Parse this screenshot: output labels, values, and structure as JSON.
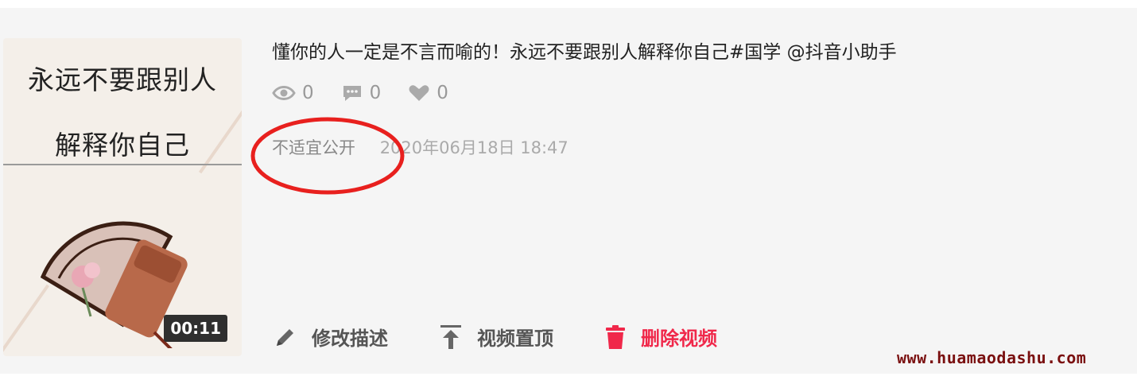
{
  "video": {
    "thumbnail_caption_line1": "永远不要跟别人",
    "thumbnail_caption_line2": "解释你自己",
    "duration": "00:11",
    "title": "懂你的人一定是不言而喻的！永远不要跟别人解释你自己#国学 @抖音小助手",
    "stats": {
      "views": "0",
      "comments": "0",
      "likes": "0"
    },
    "privacy_status": "不适宜公开",
    "timestamp": "2020年06月18日 18:47"
  },
  "actions": {
    "edit_label": "修改描述",
    "pin_label": "视频置顶",
    "delete_label": "删除视频"
  },
  "watermark": "www.huamaodashu.com",
  "colors": {
    "background": "#f5f5f5",
    "delete_red": "#f0284a",
    "annotation_red": "#e8201e",
    "watermark": "#7a1010"
  }
}
